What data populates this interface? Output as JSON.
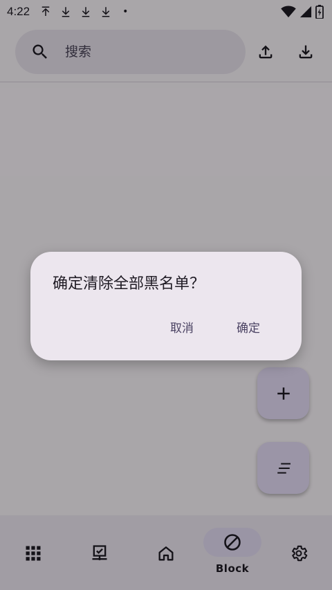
{
  "status_bar": {
    "time": "4:22",
    "left_icons": [
      "upload-arrow-icon",
      "download-arrow-icon",
      "download-arrow-icon",
      "download-arrow-icon"
    ],
    "dot": "•"
  },
  "search": {
    "placeholder": "搜索"
  },
  "top_actions": [
    "upload-icon",
    "download-icon"
  ],
  "fabs": [
    "add-icon",
    "sort-icon"
  ],
  "bottom_nav": {
    "items": [
      {
        "icon": "apps-grid-icon",
        "label": ""
      },
      {
        "icon": "device-check-icon",
        "label": ""
      },
      {
        "icon": "home-icon",
        "label": ""
      },
      {
        "icon": "block-icon",
        "label": "Block"
      },
      {
        "icon": "gear-icon",
        "label": ""
      }
    ],
    "active_index": 3
  },
  "dialog": {
    "title": "确定清除全部黑名单？",
    "cancel_label": "取消",
    "confirm_label": "确定"
  },
  "colors": {
    "surface": "#fdf8fd",
    "search_bg": "#ebe5ef",
    "fab_bg": "#e7def9",
    "nav_bg": "#f1ebf5",
    "nav_active_pill": "#e6def7",
    "dialog_bg": "#ece6ee",
    "accent_text": "#4a4262"
  }
}
